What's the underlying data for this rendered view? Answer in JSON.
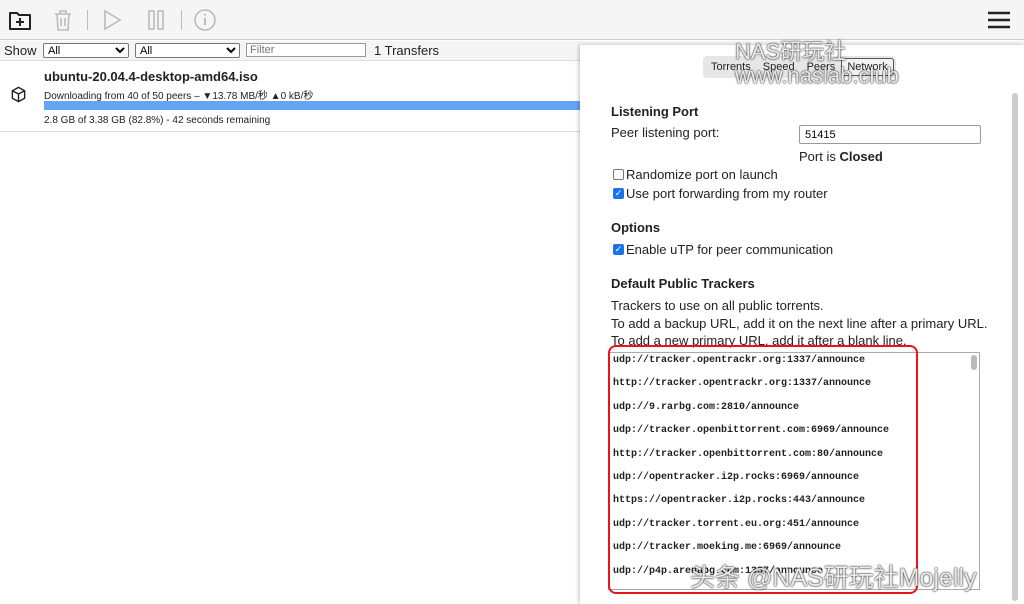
{
  "toolbar": {
    "icons": [
      "add-folder-icon",
      "trash-icon",
      "play-icon",
      "pause-icon",
      "info-icon",
      "hamburger-menu-icon"
    ]
  },
  "filter": {
    "show_label": "Show",
    "status_select": "All",
    "tracker_select": "All",
    "filter_placeholder": "Filter",
    "transfers_count": "1 Transfers"
  },
  "torrent": {
    "name": "ubuntu-20.04.4-desktop-amd64.iso",
    "peers": "Downloading from 40 of 50 peers – ▼13.78 MB/秒 ▲0 kB/秒",
    "progress_text": "2.8 GB of 3.38 GB (82.8%) - 42 seconds remaining",
    "progress_percent": 82.8,
    "progress_color": "#65a3f3"
  },
  "prefs": {
    "tabs": [
      {
        "label": "Torrents"
      },
      {
        "label": "Speed"
      },
      {
        "label": "Peers"
      },
      {
        "label": "Network",
        "active": true
      }
    ],
    "listening_port": {
      "heading": "Listening Port",
      "label": "Peer listening port:",
      "value": "51415",
      "status_prefix": "Port is",
      "status": "Closed"
    },
    "randomize": {
      "label": "Randomize port on launch",
      "checked": false
    },
    "port_forwarding": {
      "label": "Use port forwarding from my router",
      "checked": true
    },
    "options": {
      "heading": "Options",
      "utp_label": "Enable uTP for peer communication",
      "utp_checked": true
    },
    "trackers": {
      "heading": "Default Public Trackers",
      "desc1": "Trackers to use on all public torrents.",
      "desc2": "To add a backup URL, add it on the next line after a primary URL.",
      "desc3": "To add a new primary URL, add it after a blank line.",
      "list": [
        "udp://tracker.opentrackr.org:1337/announce",
        "http://tracker.opentrackr.org:1337/announce",
        "udp://9.rarbg.com:2810/announce",
        "udp://tracker.openbittorrent.com:6969/announce",
        "http://tracker.openbittorrent.com:80/announce",
        "udp://opentracker.i2p.rocks:6969/announce",
        "https://opentracker.i2p.rocks:443/announce",
        "udp://tracker.torrent.eu.org:451/announce",
        "udp://tracker.moeking.me:6969/announce",
        "udp://p4p.arenabg.com:1337/announce"
      ]
    },
    "highlight_color": "#e8131c"
  },
  "watermark": {
    "top": "NAS研玩社 www.naslab.club",
    "bottom": "头条 @NAS研玩社Mojelly"
  }
}
